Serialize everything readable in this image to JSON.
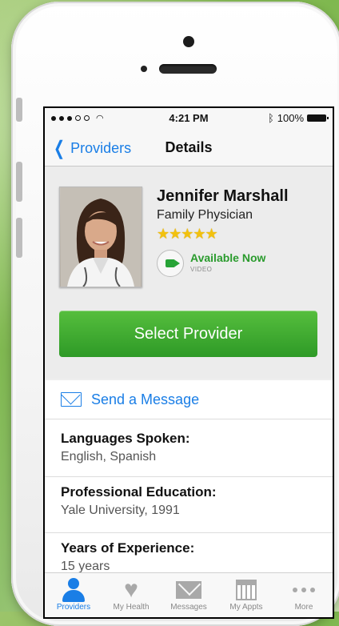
{
  "status_bar": {
    "time": "4:21 PM",
    "battery": "100%"
  },
  "nav": {
    "back_label": "Providers",
    "title": "Details"
  },
  "provider": {
    "name": "Jennifer Marshall",
    "specialty": "Family Physician",
    "rating_stars": "★★★★★",
    "availability": "Available Now",
    "availability_type": "VIDEO"
  },
  "actions": {
    "select_provider": "Select Provider",
    "send_message": "Send a Message"
  },
  "details": [
    {
      "label": "Languages Spoken:",
      "value": "English, Spanish"
    },
    {
      "label": "Professional Education:",
      "value": "Yale University, 1991"
    },
    {
      "label": "Years of Experience:",
      "value": "15 years"
    }
  ],
  "tabs": [
    {
      "label": "Providers",
      "icon": "person-icon",
      "active": true
    },
    {
      "label": "My Health",
      "icon": "heart-icon",
      "active": false
    },
    {
      "label": "Messages",
      "icon": "envelope-icon",
      "active": false
    },
    {
      "label": "My Appts",
      "icon": "calendar-icon",
      "active": false
    },
    {
      "label": "More",
      "icon": "more-icon",
      "active": false
    }
  ],
  "colors": {
    "accent": "#1a7ee6",
    "green": "#2e9a27",
    "star": "#f2c10e"
  }
}
